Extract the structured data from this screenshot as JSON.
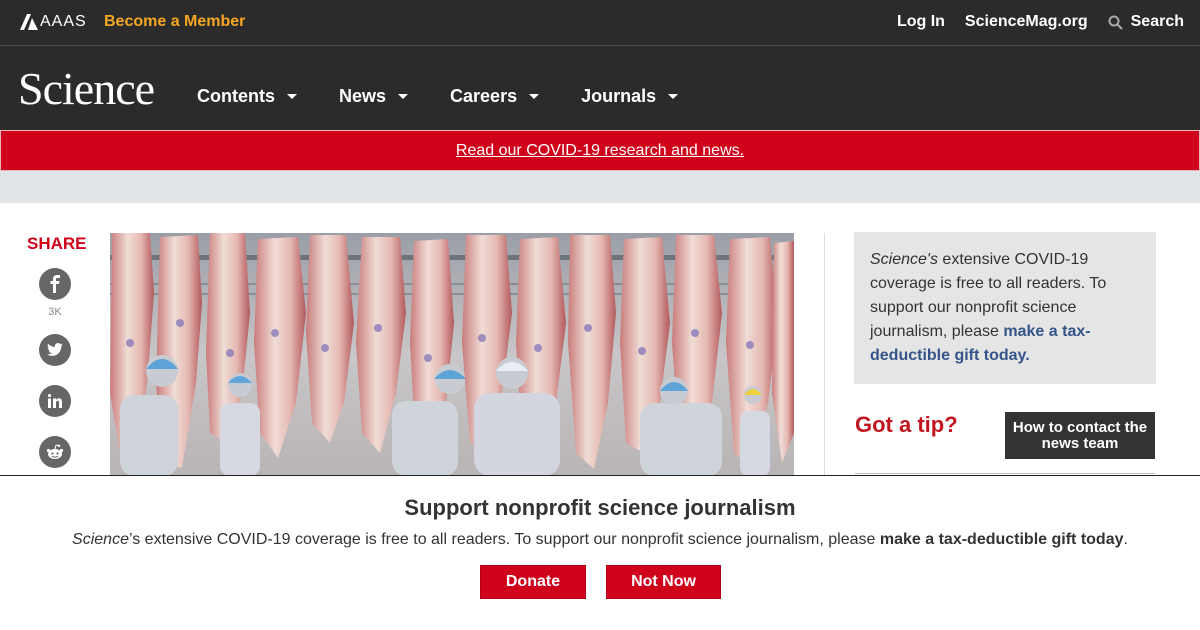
{
  "top_bar": {
    "logo_text": "AAAS",
    "become_member": "Become a Member",
    "login": "Log In",
    "sciencemag": "ScienceMag.org",
    "search": "Search"
  },
  "nav": {
    "logo": "Science",
    "items": [
      "Contents",
      "News",
      "Careers",
      "Journals"
    ]
  },
  "banner": {
    "link": "Read our COVID-19 research and news."
  },
  "share": {
    "title": "SHARE",
    "facebook_count": "3K"
  },
  "sidebar": {
    "promo_italic": "Science's",
    "promo_text": " extensive COVID-19 coverage is free to all readers. To support our nonprofit science journalism, please ",
    "promo_link": "make a tax-deductible gift today.",
    "tip_title": "Got a tip?",
    "contact_button": "How to contact the news team"
  },
  "overlay": {
    "title": "Support nonprofit science journalism",
    "text_italic": "Science",
    "text_main": "’s extensive COVID-19 coverage is free to all readers. To support our nonprofit science journalism, please ",
    "text_bold": "make a tax-deductible gift today",
    "text_end": ".",
    "donate": "Donate",
    "not_now": "Not Now"
  },
  "colors": {
    "header_bg": "#2b2b2b",
    "accent_red": "#d0021b",
    "member_orange": "#f5a623",
    "link_blue": "#35558a"
  }
}
